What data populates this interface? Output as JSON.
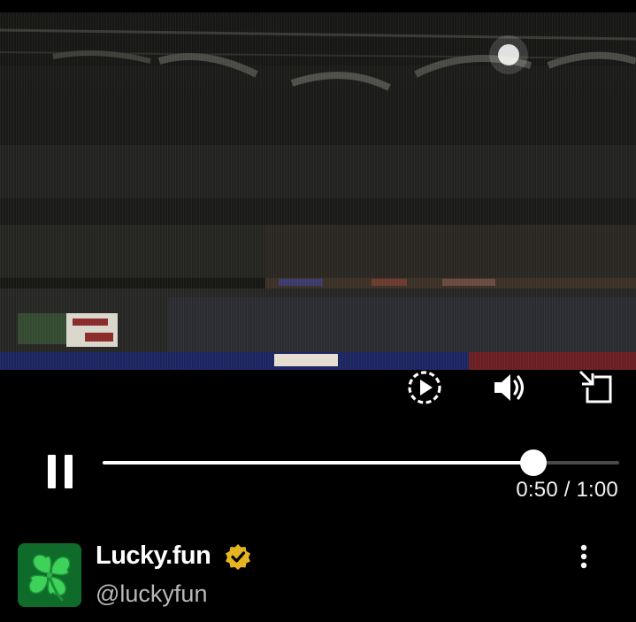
{
  "player": {
    "video_description_icon": "stadium-crowd-video-frame",
    "controls": {
      "replay_icon": "replay-icon",
      "volume_icon": "volume-icon",
      "popout_icon": "picture-in-picture-icon",
      "pause_icon": "pause-icon"
    },
    "progress": {
      "fraction": 0.8333,
      "current_time": "0:50",
      "duration": "1:00",
      "time_display": "0:50 / 1:00"
    }
  },
  "channel": {
    "name": "Lucky.fun",
    "handle": "@luckyfun",
    "verified": true,
    "verified_color": "#E6B422",
    "avatar_icon": "four-leaf-clover-icon",
    "avatar_bg": "#0e6b2a",
    "more_icon": "more-vertical-icon"
  }
}
